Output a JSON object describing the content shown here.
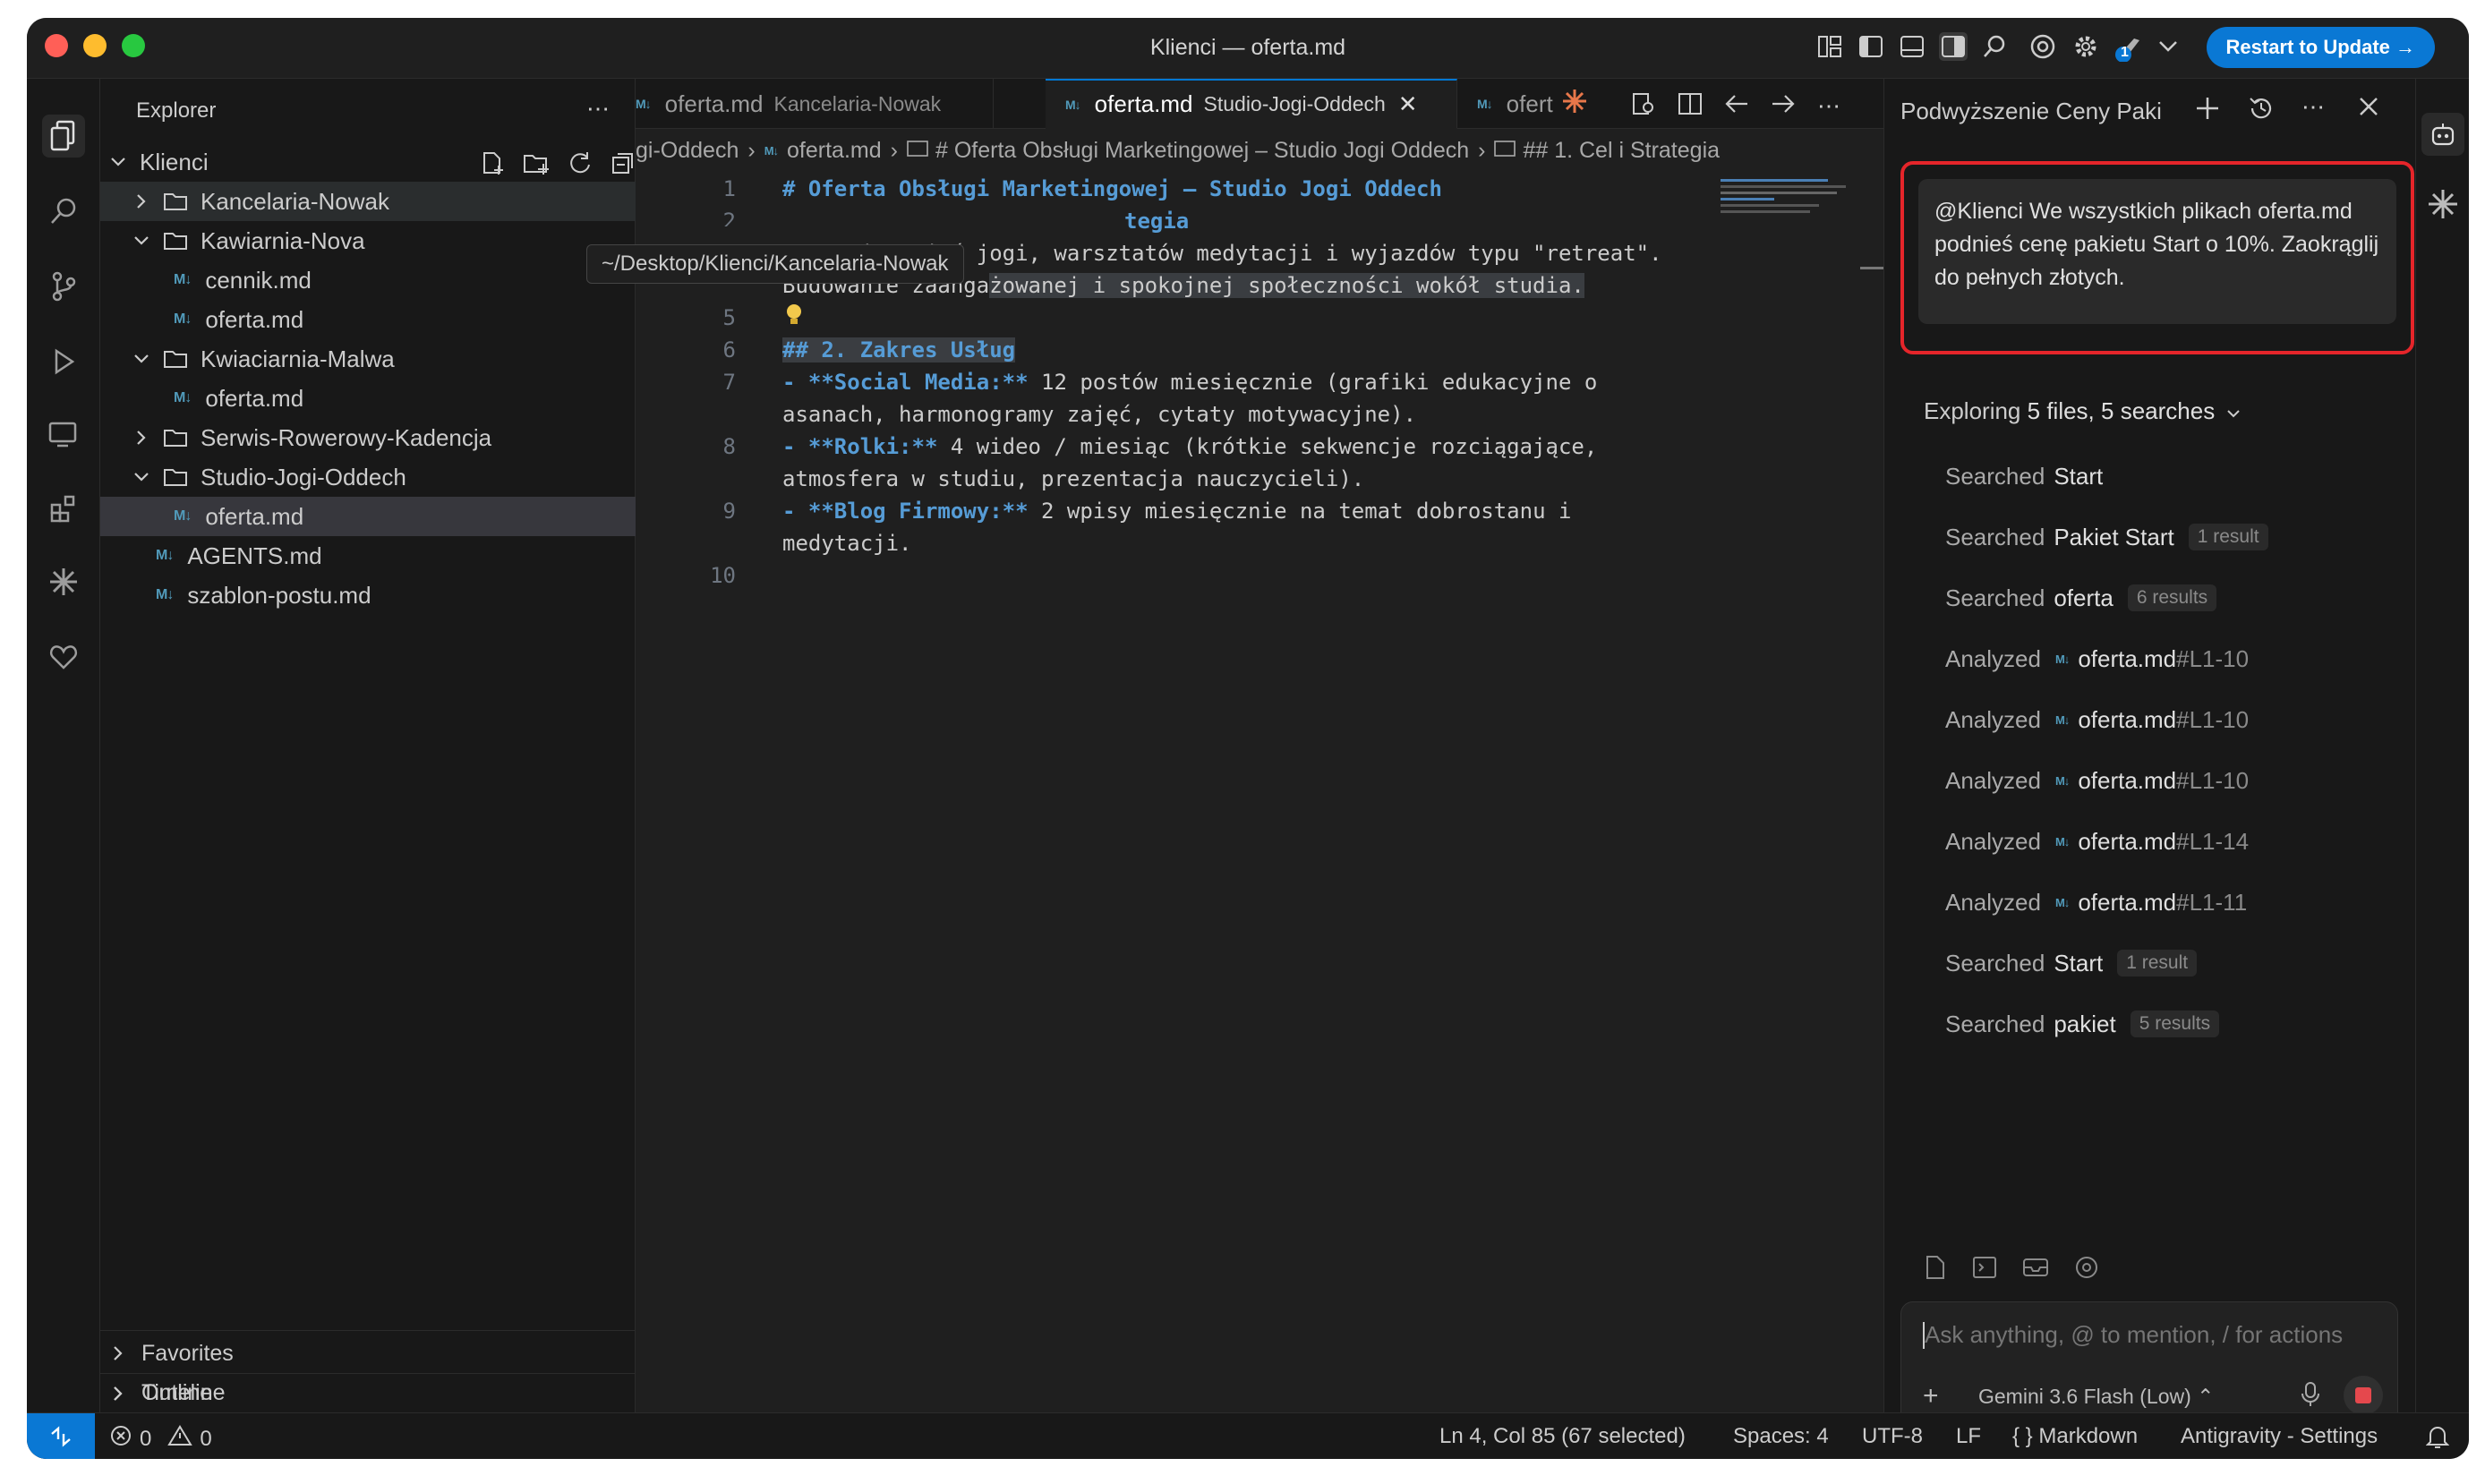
{
  "window": {
    "title": "Klienci — oferta.md",
    "restart_label": "Restart to Update →",
    "notification_badge": "1"
  },
  "explorer": {
    "header": "Explorer",
    "root": "Klienci",
    "tree": [
      {
        "label": "Kancelaria-Nowak",
        "type": "folder",
        "expanded": false
      },
      {
        "label": "Kawiarnia-Nova",
        "type": "folder",
        "expanded": true
      },
      {
        "label": "cennik.md",
        "type": "file"
      },
      {
        "label": "oferta.md",
        "type": "file"
      },
      {
        "label": "Kwiaciarnia-Malwa",
        "type": "folder",
        "expanded": true
      },
      {
        "label": "oferta.md",
        "type": "file"
      },
      {
        "label": "Serwis-Rowerowy-Kadencja",
        "type": "folder",
        "expanded": false
      },
      {
        "label": "Studio-Jogi-Oddech",
        "type": "folder",
        "expanded": true
      },
      {
        "label": "oferta.md",
        "type": "file",
        "selected": true
      },
      {
        "label": "AGENTS.md",
        "type": "file"
      },
      {
        "label": "szablon-postu.md",
        "type": "file"
      }
    ],
    "tooltip": "~/Desktop/Klienci/Kancelaria-Nowak",
    "sections": [
      "Favorites",
      "Outline",
      "Timeline"
    ]
  },
  "editor": {
    "tabs": [
      {
        "name": "oferta.md",
        "sub": "Kancelaria-Nowak"
      },
      {
        "name": "oferta.md",
        "sub": "Studio-Jogi-Oddech",
        "active": true
      },
      {
        "name": "ofert",
        "sub": ""
      }
    ],
    "breadcrumb": [
      "gi-Oddech",
      "oferta.md",
      "# Oferta Obsługi Marketingowej – Studio Jogi Oddech",
      "## 1. Cel i Strategia"
    ],
    "line_numbers": [
      "1",
      "2",
      "4",
      "5",
      "6",
      "7",
      "8",
      "9",
      "10"
    ],
    "lines": {
      "l1": "# Oferta Obsługi Marketingowej – Studio Jogi Oddech",
      "l3_tail": "tegia",
      "l4a": "Promocja zajęć jogi, warsztatów medytacji i wyjazdów typu \"retreat\".",
      "l4b_pre": "Budowanie zaanga",
      "l4b_sel": "żowanej i spokojnej społeczności wokół studia.",
      "l6": "## 2. Zakres Usług",
      "l7_b": "- **Social Media:**",
      "l7_r": " 12 postów miesięcznie (grafiki edukacyjne o",
      "l7b": "asanach, harmonogramy zajęć, cytaty motywacyjne).",
      "l8_b": "- **Rolki:**",
      "l8_r": " 4 wideo / miesiąc (krótkie sekwencje rozciągające,",
      "l8b": "atmosfera w studiu, prezentacja nauczycieli).",
      "l9_b": "- **Blog Firmowy:**",
      "l9_r": " 2 wpisy miesięcznie na temat dobrostanu i",
      "l9b": "medytacji."
    }
  },
  "agent": {
    "title": "Podwyższenie Ceny Paki",
    "prompt": "@Klienci We wszystkich plikach oferta.md podnieś cenę pakietu Start o 10%. Zaokrąglij do pełnych złotych.",
    "exploring_prefix": "Exploring",
    "exploring_bold": "5 files, 5 searches",
    "actions": [
      {
        "verb": "Searched",
        "target": "Start",
        "badge": ""
      },
      {
        "verb": "Searched",
        "target": "Pakiet Start",
        "badge": "1 result"
      },
      {
        "verb": "Searched",
        "target": "oferta",
        "badge": "6 results"
      },
      {
        "verb": "Analyzed",
        "target": "oferta.md",
        "range": "#L1-10"
      },
      {
        "verb": "Analyzed",
        "target": "oferta.md",
        "range": "#L1-10"
      },
      {
        "verb": "Analyzed",
        "target": "oferta.md",
        "range": "#L1-10"
      },
      {
        "verb": "Analyzed",
        "target": "oferta.md",
        "range": "#L1-14"
      },
      {
        "verb": "Analyzed",
        "target": "oferta.md",
        "range": "#L1-11"
      },
      {
        "verb": "Searched",
        "target": "Start",
        "badge": "1 result"
      },
      {
        "verb": "Searched",
        "target": "pakiet",
        "badge": "5 results"
      }
    ],
    "input_placeholder": "Ask anything, @ to mention, / for actions",
    "model": "Gemini 3.6 Flash (Low)"
  },
  "status": {
    "errors": "0",
    "warnings": "0",
    "position": "Ln 4, Col 85 (67 selected)",
    "spaces": "Spaces: 4",
    "encoding": "UTF-8",
    "eol": "LF",
    "language": "Markdown",
    "settings": "Antigravity - Settings"
  },
  "colors": {
    "accent": "#0a78d4",
    "highlight_border": "#e5252a",
    "markdown_icon": "#519aba",
    "heading": "#569cd6"
  }
}
